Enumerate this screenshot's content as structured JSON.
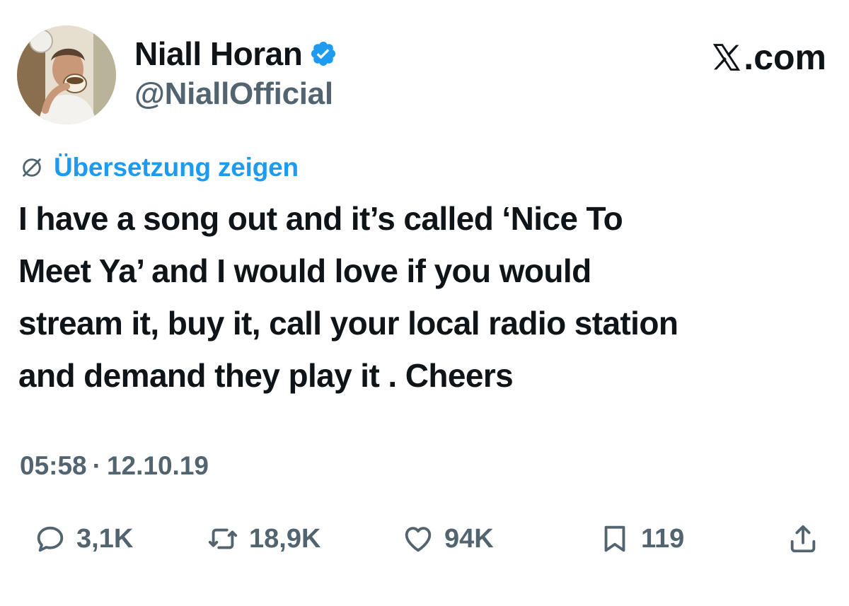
{
  "author": {
    "display_name": "Niall Horan",
    "handle": "@NiallOfficial",
    "verified": true,
    "verified_color": "#1d9bf0"
  },
  "brand": {
    "label": ".com",
    "logo_icon": "x-logo-icon"
  },
  "translate": {
    "label": "Übersetzung zeigen",
    "icon": "globe-icon",
    "color": "#1d9bf0"
  },
  "tweet": {
    "text": "I have a song out and it’s called ‘Nice To\nMeet Ya’ and I would love if you would\nstream it, buy it, call your local radio station\nand demand they play it . Cheers"
  },
  "meta": {
    "time": "05:58",
    "separator": "·",
    "date": "12.10.19"
  },
  "actions": {
    "replies": "3,1K",
    "reposts": "18,9K",
    "likes": "94K",
    "bookmarks": "119"
  },
  "colors": {
    "text": "#0f1419",
    "muted": "#536471",
    "accent": "#1d9bf0",
    "background": "#ffffff"
  }
}
